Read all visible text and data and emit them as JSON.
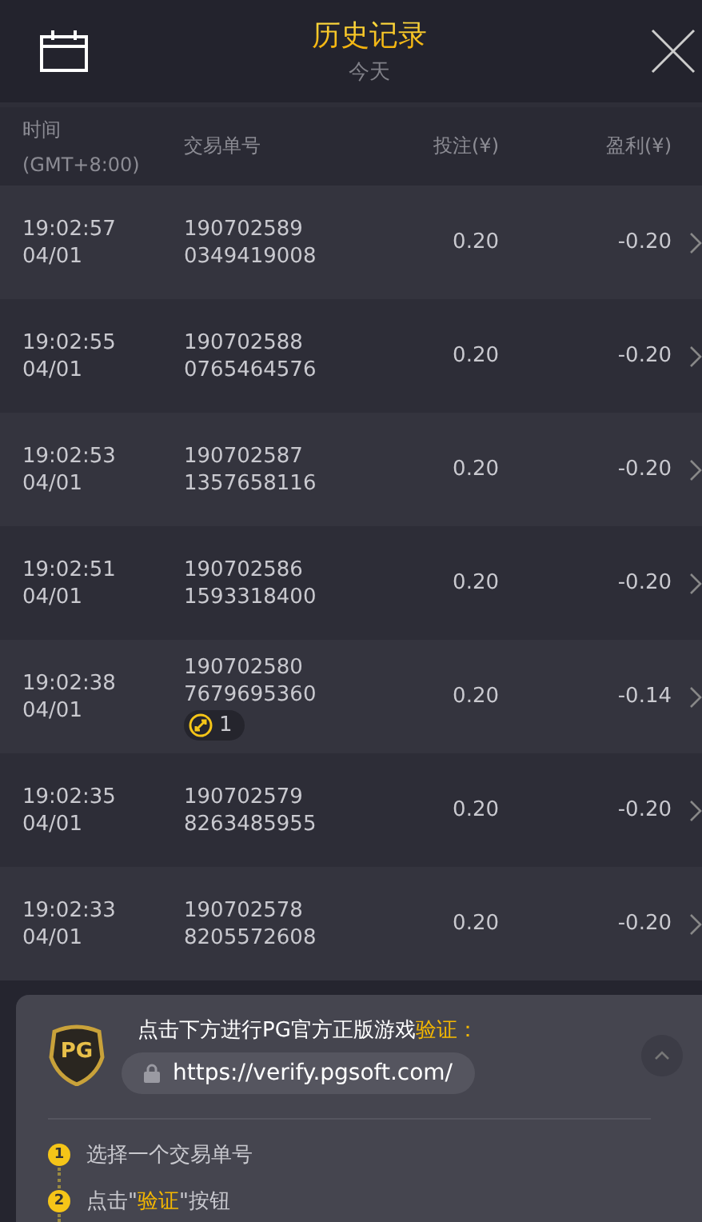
{
  "header": {
    "title": "历史记录",
    "subtitle": "今天"
  },
  "columns": [
    {
      "lines": [
        "时间",
        "(GMT+8:00)"
      ]
    },
    {
      "lines": [
        "交易单号"
      ]
    },
    {
      "lines": [
        "投注(¥)"
      ]
    },
    {
      "lines": [
        "盈利(¥)"
      ]
    }
  ],
  "rows": [
    {
      "time": "19:02:57",
      "date": "04/01",
      "id_lines": [
        "190702589",
        "0349419008"
      ],
      "bet": "0.20",
      "profit": "-0.20"
    },
    {
      "time": "19:02:55",
      "date": "04/01",
      "id_lines": [
        "190702588",
        "0765464576"
      ],
      "bet": "0.20",
      "profit": "-0.20"
    },
    {
      "time": "19:02:53",
      "date": "04/01",
      "id_lines": [
        "190702587",
        "1357658116"
      ],
      "bet": "0.20",
      "profit": "-0.20"
    },
    {
      "time": "19:02:51",
      "date": "04/01",
      "id_lines": [
        "190702586",
        "1593318400"
      ],
      "bet": "0.20",
      "profit": "-0.20"
    },
    {
      "time": "19:02:38",
      "date": "04/01",
      "id_lines": [
        "190702580",
        "7679695360"
      ],
      "badge": "1",
      "bet": "0.20",
      "profit": "-0.14"
    },
    {
      "time": "19:02:35",
      "date": "04/01",
      "id_lines": [
        "190702579",
        "8263485955"
      ],
      "bet": "0.20",
      "profit": "-0.20"
    },
    {
      "time": "19:02:33",
      "date": "04/01",
      "id_lines": [
        "190702578",
        "8205572608"
      ],
      "bet": "0.20",
      "profit": "-0.20"
    }
  ],
  "verify_panel": {
    "logo_text": "PG",
    "title": [
      {
        "text": "点击下方进行PG官方正版游戏",
        "highlight": false
      },
      {
        "text": "验证：",
        "highlight": true
      }
    ],
    "url": "https://verify.pgsoft.com/",
    "steps": [
      {
        "number": "1",
        "parts": [
          {
            "text": "选择一个交易单号",
            "highlight": false
          }
        ]
      },
      {
        "number": "2",
        "parts": [
          {
            "text": "点击\"",
            "highlight": false
          },
          {
            "text": "验证",
            "highlight": true
          },
          {
            "text": "\"按钮",
            "highlight": false
          }
        ]
      }
    ]
  }
}
